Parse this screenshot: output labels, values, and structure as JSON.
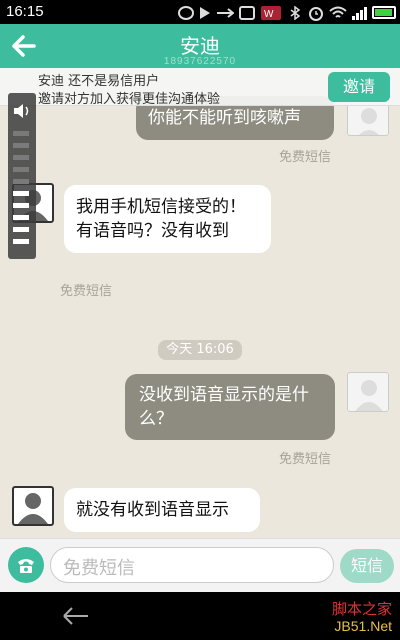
{
  "status": {
    "time": "16:15",
    "network": "3G"
  },
  "header": {
    "title": "安迪",
    "phone": "18937622570"
  },
  "invite": {
    "line1": "安迪 还不是易信用户",
    "line2": "邀请对方加入获得更佳沟通体验",
    "button": "邀请"
  },
  "volume": {
    "level": 0.5,
    "levels_total": 10
  },
  "messages": [
    {
      "dir": "out",
      "text": "你能不能听到咳嗽声",
      "note": "免费短信"
    },
    {
      "dir": "in",
      "text": "我用手机短信接受的！有语音吗？没有收到",
      "note": "免费短信"
    },
    {
      "dir": "out",
      "text": "没收到语音显示的是什么？",
      "note": "免费短信"
    },
    {
      "dir": "in",
      "text": "就没有收到语音显示",
      "note": ""
    }
  ],
  "divider": {
    "time": "今天 16:06"
  },
  "composer": {
    "placeholder": "免费短信",
    "send_label": "短信"
  },
  "watermark": {
    "line1": "脚本之家",
    "line2": "JB51.Net"
  },
  "colors": {
    "accent": "#3dbd9d",
    "chat_bg": "#ece7dc",
    "outgoing_bubble": "#8e8c80"
  }
}
